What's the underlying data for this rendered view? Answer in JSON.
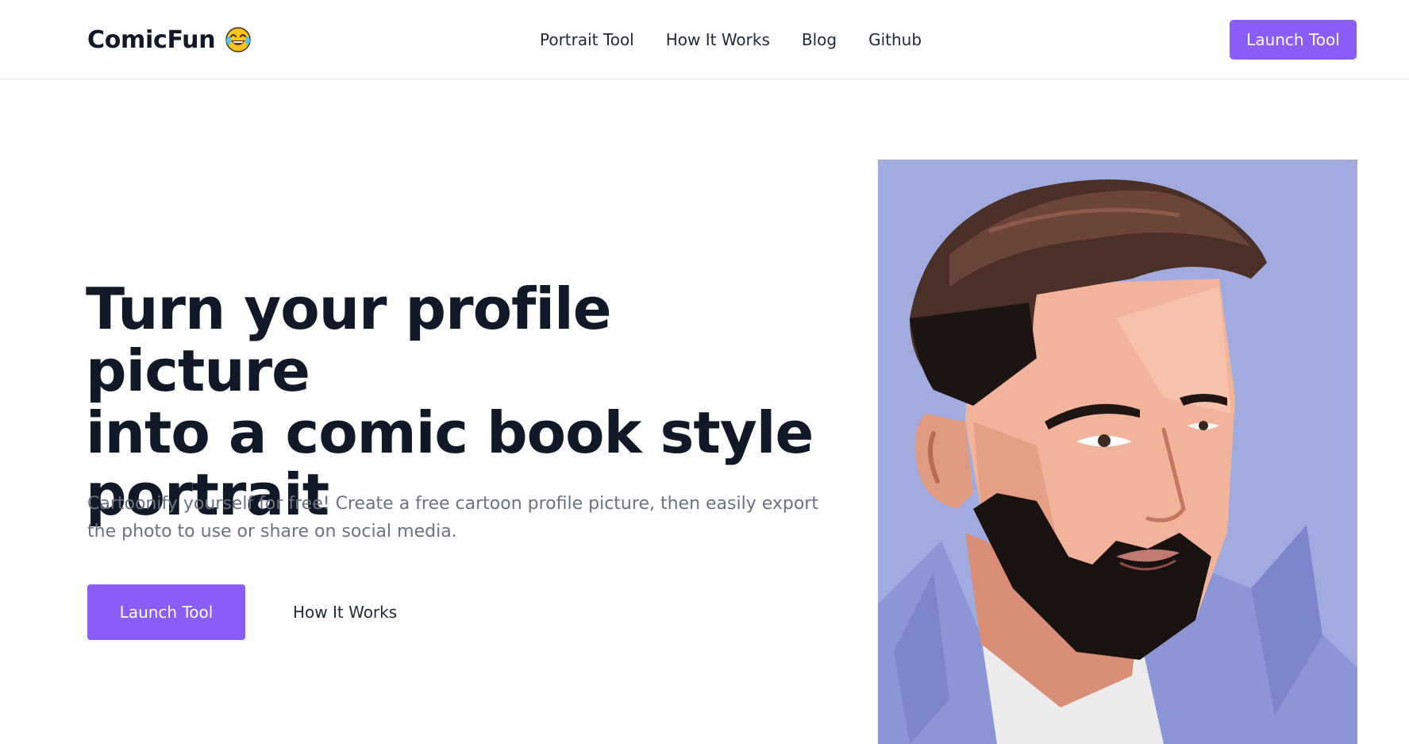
{
  "header": {
    "brand": "ComicFun",
    "brand_emoji_icon": "laughing-tears-emoji-icon",
    "nav": [
      {
        "label": "Portrait Tool"
      },
      {
        "label": "How It Works"
      },
      {
        "label": "Blog"
      },
      {
        "label": "Github"
      }
    ],
    "cta_label": "Launch Tool"
  },
  "hero": {
    "title_lines": [
      "Turn your profile picture",
      "into a comic book style",
      "portrait"
    ],
    "subtitle_lines": [
      "Cartoonify yourself for free! Create a free cartoon profile picture, then easily export",
      "the photo to use or share on social media."
    ],
    "primary_cta": "Launch Tool",
    "secondary_cta": "How It Works"
  },
  "colors": {
    "accent": "#8b5cf6",
    "heading": "#111827",
    "body_text": "#6b7280",
    "portrait_background": "#a1abe0"
  }
}
